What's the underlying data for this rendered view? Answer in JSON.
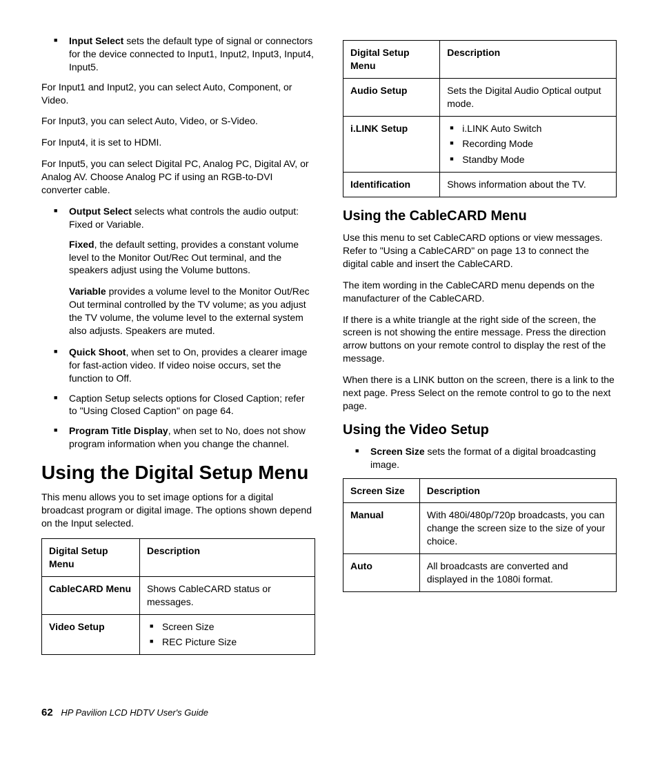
{
  "left": {
    "bullets_top": [
      {
        "bold": "Input Select",
        "text": " sets the default type of signal or connectors for the device connected to Input1, Input2, Input3, Input4, Input5."
      }
    ],
    "p1": "For Input1 and Input2, you can select Auto, Component, or Video.",
    "p2": "For Input3, you can select Auto, Video, or S-Video.",
    "p3": "For Input4, it is set to HDMI.",
    "p4": "For Input5, you can select Digital PC, Analog PC, Digital AV, or Analog AV. Choose Analog PC if using an RGB-to-DVI converter cable.",
    "output_select_bold": "Output Select",
    "output_select_text": " selects what controls the audio output: Fixed or Variable.",
    "fixed_bold": "Fixed",
    "fixed_text": ", the default setting, provides a constant volume level to the Monitor Out/Rec Out terminal, and the speakers adjust using the Volume buttons.",
    "variable_bold": "Variable",
    "variable_text": " provides a volume level to the Monitor Out/Rec Out terminal controlled by the TV volume; as you adjust the TV volume, the volume level to the external system also adjusts. Speakers are muted.",
    "quick_shoot_bold": "Quick Shoot",
    "quick_shoot_text": ", when set to On, provides a clearer image for fast-action video. If video noise occurs, set the function to Off.",
    "caption_text": "Caption Setup selects options for Closed Caption; refer to \"Using Closed Caption\" on page 64.",
    "program_title_bold": "Program Title Display",
    "program_title_text": ", when set to No, does not show program information when you change the channel.",
    "h1": "Using the Digital Setup Menu",
    "h1_desc": "This menu allows you to set image options for a digital broadcast program or digital image. The options shown depend on the Input selected.",
    "table1": {
      "h1": "Digital Setup Menu",
      "h2": "Description",
      "rows": [
        {
          "label": "CableCARD Menu",
          "desc": "Shows CableCARD status or messages."
        },
        {
          "label": "Video Setup",
          "items": [
            "Screen Size",
            "REC Picture Size"
          ]
        }
      ]
    }
  },
  "right": {
    "table2": {
      "h1": "Digital Setup Menu",
      "h2": "Description",
      "rows": [
        {
          "label": "Audio Setup",
          "desc": "Sets the Digital Audio Optical output mode."
        },
        {
          "label": "i.LINK Setup",
          "items": [
            "i.LINK Auto Switch",
            "Recording Mode",
            "Standby Mode"
          ]
        },
        {
          "label": "Identification",
          "desc": "Shows information about the TV."
        }
      ]
    },
    "h2a": "Using the CableCARD Menu",
    "cc_p1": "Use this menu to set CableCARD options or view messages. Refer to \"Using a CableCARD\" on page 13 to connect the digital cable and insert the CableCARD.",
    "cc_p2": "The item wording in the CableCARD menu depends on the manufacturer of the CableCARD.",
    "cc_p3": "If there is a white triangle at the right side of the screen, the screen is not showing the entire message. Press the direction arrow buttons on your remote control to display the rest of the message.",
    "cc_p4": "When there is a LINK button on the screen, there is a link to the next page. Press Select on the remote control to go to the next page.",
    "h2b": "Using the Video Setup",
    "vs_bullet_bold": "Screen Size",
    "vs_bullet_text": " sets the format of a digital broadcasting image.",
    "table3": {
      "h1": "Screen Size",
      "h2": "Description",
      "rows": [
        {
          "label": "Manual",
          "desc": "With 480i/480p/720p broadcasts, you can change the screen size to the size of your choice."
        },
        {
          "label": "Auto",
          "desc": "All broadcasts are converted and displayed in the 1080i format."
        }
      ]
    }
  },
  "footer": {
    "page": "62",
    "title": "HP Pavilion LCD HDTV User's Guide"
  }
}
